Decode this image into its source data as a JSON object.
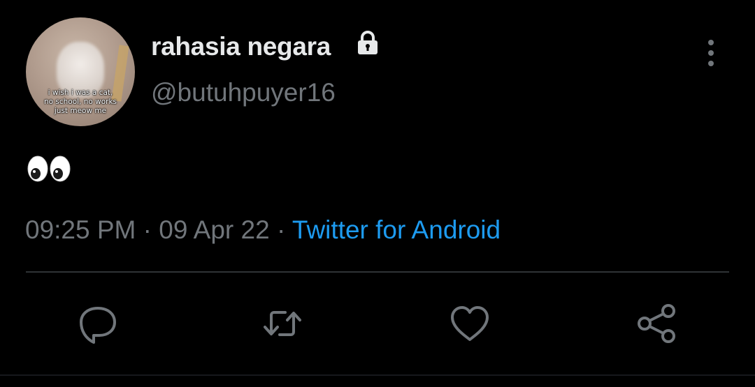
{
  "tweet": {
    "display_name": "rahasia negara",
    "handle": "@butuhpuyer16",
    "protected_icon": "lock-icon",
    "text_emoji": "eyes-emoji",
    "avatar": {
      "caption_lines": [
        "i wish i was a cat,",
        "no school, no works",
        "just meow me"
      ]
    },
    "time": "09:25 PM",
    "separator": "·",
    "date": "09 Apr 22",
    "source": "Twitter for Android"
  },
  "actions": {
    "reply_icon": "reply-icon",
    "retweet_icon": "retweet-icon",
    "like_icon": "heart-icon",
    "share_icon": "share-icon"
  },
  "colors": {
    "background": "#000000",
    "primary_text": "#e7e9ea",
    "secondary_text": "#71767b",
    "link": "#1d9bf0",
    "divider": "#2f3336"
  }
}
